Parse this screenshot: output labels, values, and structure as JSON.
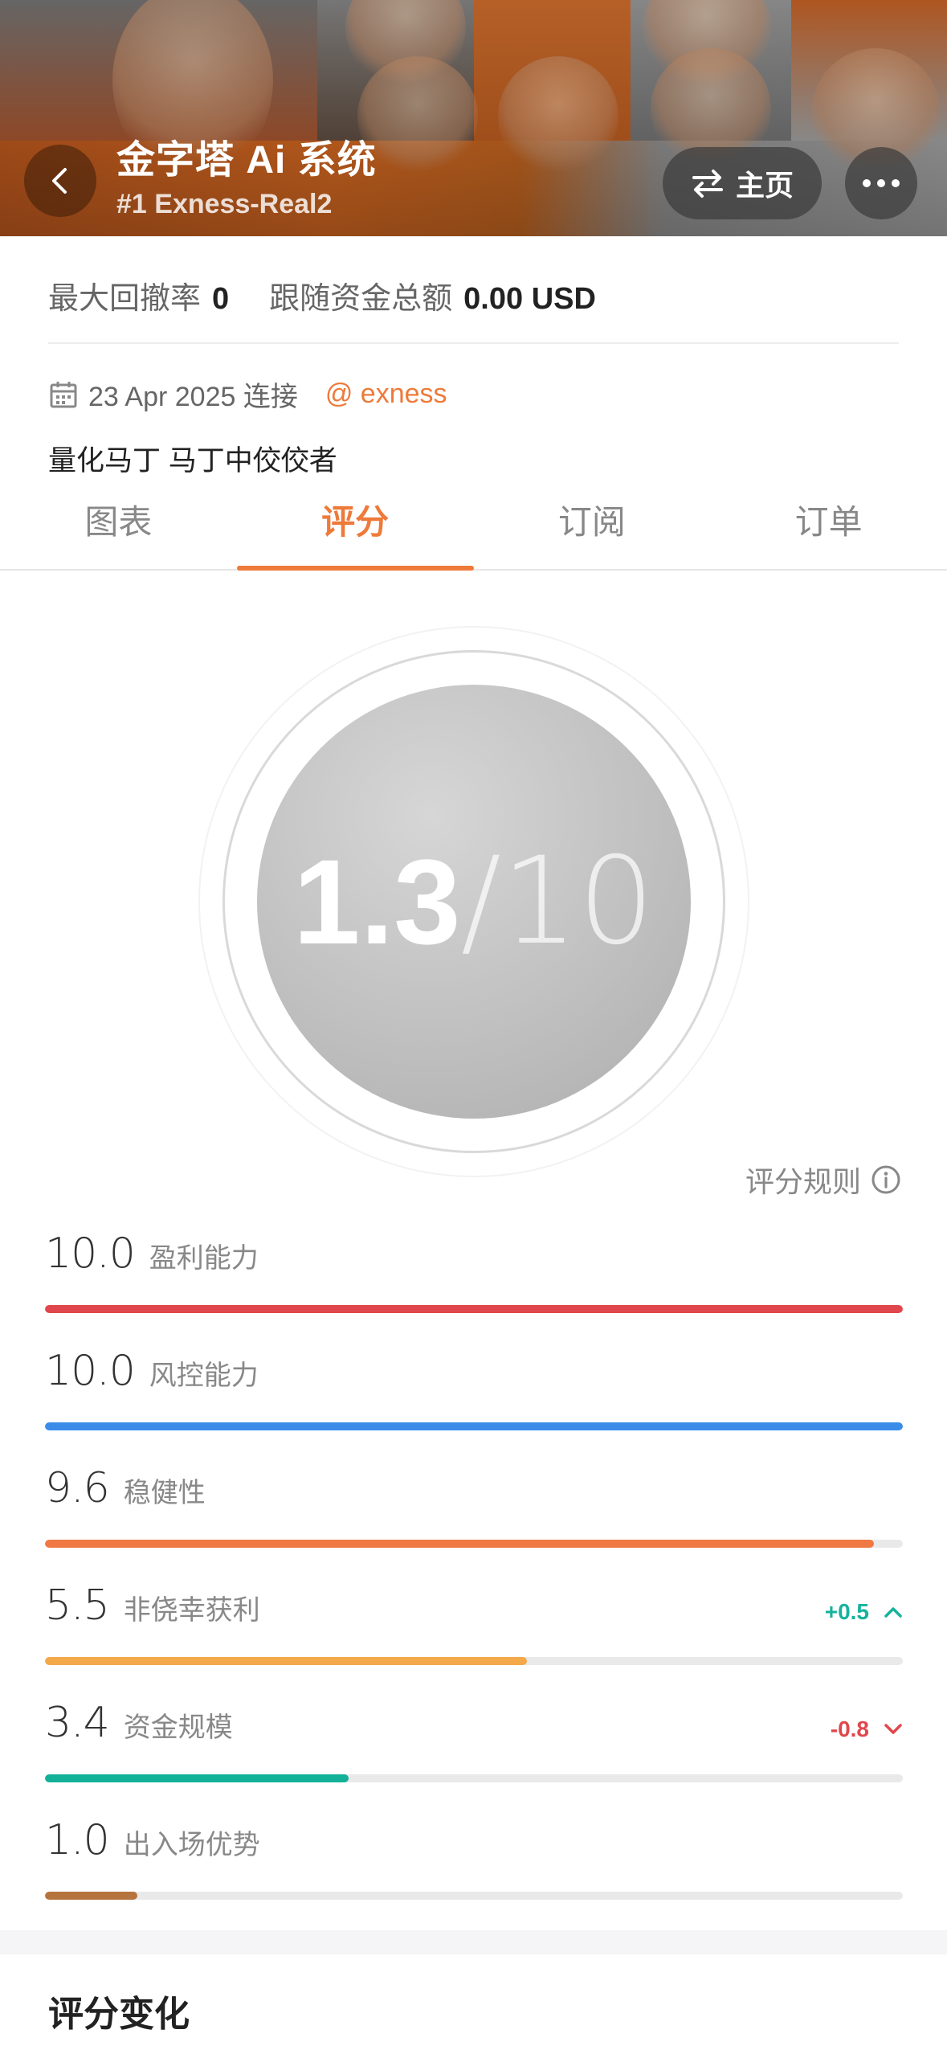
{
  "header": {
    "title": "金字塔 Ai 系统",
    "subtitle": "#1 Exness-Real2",
    "home_label": "主页",
    "back_icon": "chevron-left-icon",
    "swap_icon": "swap-arrows-icon",
    "more_icon": "more-dots-icon"
  },
  "info": {
    "max_drawdown_label": "最大回撤率",
    "max_drawdown_value": "0",
    "follow_total_label": "跟随资金总额",
    "follow_total_value": "0.00 USD",
    "connected_date": "23 Apr 2025 连接",
    "broker": "@ exness",
    "description": "量化马丁 马丁中佼佼者"
  },
  "tabs": [
    {
      "label": "图表",
      "active": false
    },
    {
      "label": "评分",
      "active": true
    },
    {
      "label": "订阅",
      "active": false
    },
    {
      "label": "订单",
      "active": false
    }
  ],
  "score": {
    "value": "1.3",
    "max_text": "/10",
    "rules_label": "评分规则"
  },
  "metrics": [
    {
      "value": "10.0",
      "label": "盈利能力",
      "fraction": 1.0,
      "color": "#e0474c",
      "delta": ""
    },
    {
      "value": "10.0",
      "label": "风控能力",
      "fraction": 1.0,
      "color": "#3b8ce8",
      "delta": ""
    },
    {
      "value": "9.6",
      "label": "稳健性",
      "fraction": 0.966,
      "color": "#ef7843",
      "delta": ""
    },
    {
      "value": "5.5",
      "label": "非侥幸获利",
      "fraction": 0.562,
      "color": "#f3a94a",
      "delta": "+0.5",
      "delta_color": "#16b29c",
      "delta_dir": "up"
    },
    {
      "value": "3.4",
      "label": "资金规模",
      "fraction": 0.354,
      "color": "#13b098",
      "delta": "-0.8",
      "delta_color": "#e0474c",
      "delta_dir": "down"
    },
    {
      "value": "1.0",
      "label": "出入场优势",
      "fraction": 0.108,
      "color": "#b5733e",
      "delta": ""
    }
  ],
  "section": {
    "title": "评分变化"
  }
}
